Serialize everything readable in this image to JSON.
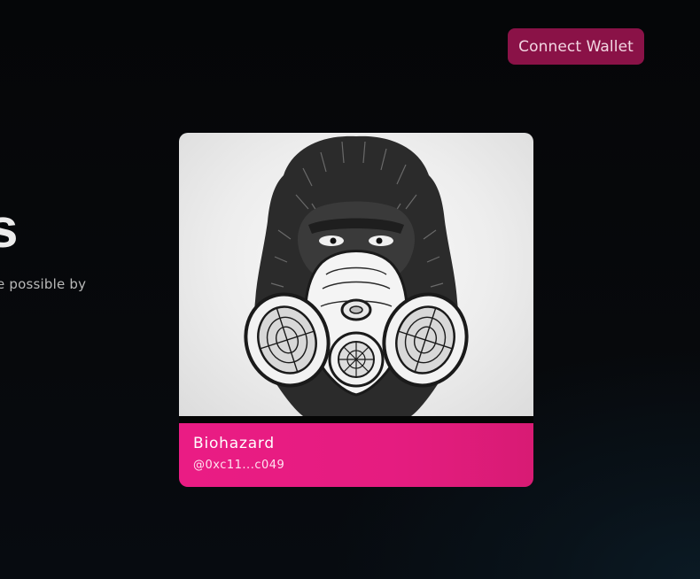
{
  "header": {
    "connect_wallet_label": "Connect Wallet"
  },
  "hero": {
    "title_fragment": "s",
    "subtitle_fragment": "e possible by"
  },
  "card": {
    "title": "Biohazard",
    "owner": "@0xc11...c049",
    "image_icon": "gorilla-gas-mask-icon"
  },
  "colors": {
    "button": "#8a1247",
    "card_footer": "#e51c80",
    "background": "#050608"
  }
}
